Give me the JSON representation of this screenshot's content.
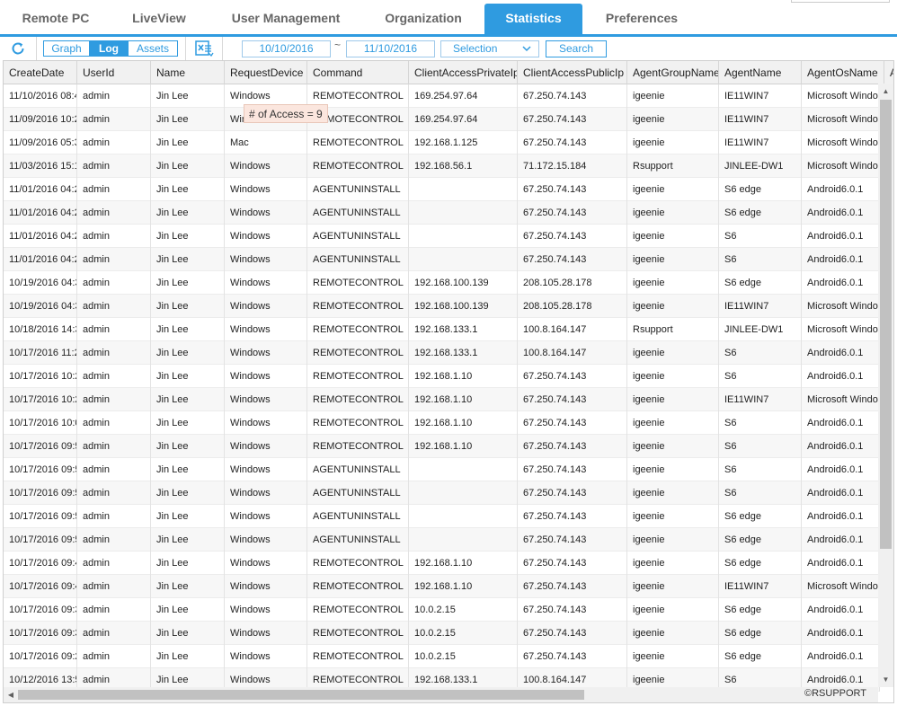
{
  "tabs": [
    {
      "label": "Remote PC",
      "active": false
    },
    {
      "label": "LiveView",
      "active": false
    },
    {
      "label": "User Management",
      "active": false
    },
    {
      "label": "Organization",
      "active": false
    },
    {
      "label": "Statistics",
      "active": true
    },
    {
      "label": "Preferences",
      "active": false
    }
  ],
  "toolbar": {
    "refresh_icon": "refresh-icon",
    "view_modes": [
      {
        "label": "Graph",
        "active": false
      },
      {
        "label": "Log",
        "active": true
      },
      {
        "label": "Assets",
        "active": false
      }
    ],
    "export_icon": "excel-export-icon",
    "date_from": "10/10/2016",
    "date_sep": "~",
    "date_to": "11/10/2016",
    "selection_label": "Selection",
    "search_label": "Search"
  },
  "tooltip": "# of Access = 9",
  "table": {
    "columns": [
      "CreateDate",
      "UserId",
      "Name",
      "RequestDevice",
      "Command",
      "ClientAccessPrivateIp",
      "ClientAccessPublicIp",
      "AgentGroupName",
      "AgentName",
      "AgentOsName",
      "A"
    ],
    "rows": [
      [
        "11/10/2016 08:4",
        "admin",
        "Jin Lee",
        "Windows",
        "REMOTECONTROL",
        "169.254.97.64",
        "67.250.74.143",
        "igeenie",
        "IE11WIN7",
        "Microsoft Window"
      ],
      [
        "11/09/2016 10:2",
        "admin",
        "Jin Lee",
        "Wir",
        "REMOTECONTROL",
        "169.254.97.64",
        "67.250.74.143",
        "igeenie",
        "IE11WIN7",
        "Microsoft Window"
      ],
      [
        "11/09/2016 05:3",
        "admin",
        "Jin Lee",
        "Mac",
        "REMOTECONTROL",
        "192.168.1.125",
        "67.250.74.143",
        "igeenie",
        "IE11WIN7",
        "Microsoft Window"
      ],
      [
        "11/03/2016 15:1",
        "admin",
        "Jin Lee",
        "Windows",
        "REMOTECONTROL",
        "192.168.56.1",
        "71.172.15.184",
        "Rsupport",
        "JINLEE-DW1",
        "Microsoft Window"
      ],
      [
        "11/01/2016 04:2",
        "admin",
        "Jin Lee",
        "Windows",
        "AGENTUNINSTALL",
        "",
        "67.250.74.143",
        "igeenie",
        "S6 edge",
        "Android6.0.1"
      ],
      [
        "11/01/2016 04:2",
        "admin",
        "Jin Lee",
        "Windows",
        "AGENTUNINSTALL",
        "",
        "67.250.74.143",
        "igeenie",
        "S6 edge",
        "Android6.0.1"
      ],
      [
        "11/01/2016 04:2",
        "admin",
        "Jin Lee",
        "Windows",
        "AGENTUNINSTALL",
        "",
        "67.250.74.143",
        "igeenie",
        "S6",
        "Android6.0.1"
      ],
      [
        "11/01/2016 04:2",
        "admin",
        "Jin Lee",
        "Windows",
        "AGENTUNINSTALL",
        "",
        "67.250.74.143",
        "igeenie",
        "S6",
        "Android6.0.1"
      ],
      [
        "10/19/2016 04:3",
        "admin",
        "Jin Lee",
        "Windows",
        "REMOTECONTROL",
        "192.168.100.139",
        "208.105.28.178",
        "igeenie",
        "S6 edge",
        "Android6.0.1"
      ],
      [
        "10/19/2016 04:3",
        "admin",
        "Jin Lee",
        "Windows",
        "REMOTECONTROL",
        "192.168.100.139",
        "208.105.28.178",
        "igeenie",
        "IE11WIN7",
        "Microsoft Window"
      ],
      [
        "10/18/2016 14:3",
        "admin",
        "Jin Lee",
        "Windows",
        "REMOTECONTROL",
        "192.168.133.1",
        "100.8.164.147",
        "Rsupport",
        "JINLEE-DW1",
        "Microsoft Window"
      ],
      [
        "10/17/2016 11:2",
        "admin",
        "Jin Lee",
        "Windows",
        "REMOTECONTROL",
        "192.168.133.1",
        "100.8.164.147",
        "igeenie",
        "S6",
        "Android6.0.1"
      ],
      [
        "10/17/2016 10:2",
        "admin",
        "Jin Lee",
        "Windows",
        "REMOTECONTROL",
        "192.168.1.10",
        "67.250.74.143",
        "igeenie",
        "S6",
        "Android6.0.1"
      ],
      [
        "10/17/2016 10:2",
        "admin",
        "Jin Lee",
        "Windows",
        "REMOTECONTROL",
        "192.168.1.10",
        "67.250.74.143",
        "igeenie",
        "IE11WIN7",
        "Microsoft Window"
      ],
      [
        "10/17/2016 10:0",
        "admin",
        "Jin Lee",
        "Windows",
        "REMOTECONTROL",
        "192.168.1.10",
        "67.250.74.143",
        "igeenie",
        "S6",
        "Android6.0.1"
      ],
      [
        "10/17/2016 09:5",
        "admin",
        "Jin Lee",
        "Windows",
        "REMOTECONTROL",
        "192.168.1.10",
        "67.250.74.143",
        "igeenie",
        "S6",
        "Android6.0.1"
      ],
      [
        "10/17/2016 09:5",
        "admin",
        "Jin Lee",
        "Windows",
        "AGENTUNINSTALL",
        "",
        "67.250.74.143",
        "igeenie",
        "S6",
        "Android6.0.1"
      ],
      [
        "10/17/2016 09:5",
        "admin",
        "Jin Lee",
        "Windows",
        "AGENTUNINSTALL",
        "",
        "67.250.74.143",
        "igeenie",
        "S6",
        "Android6.0.1"
      ],
      [
        "10/17/2016 09:5",
        "admin",
        "Jin Lee",
        "Windows",
        "AGENTUNINSTALL",
        "",
        "67.250.74.143",
        "igeenie",
        "S6 edge",
        "Android6.0.1"
      ],
      [
        "10/17/2016 09:5",
        "admin",
        "Jin Lee",
        "Windows",
        "AGENTUNINSTALL",
        "",
        "67.250.74.143",
        "igeenie",
        "S6 edge",
        "Android6.0.1"
      ],
      [
        "10/17/2016 09:4",
        "admin",
        "Jin Lee",
        "Windows",
        "REMOTECONTROL",
        "192.168.1.10",
        "67.250.74.143",
        "igeenie",
        "S6 edge",
        "Android6.0.1"
      ],
      [
        "10/17/2016 09:4",
        "admin",
        "Jin Lee",
        "Windows",
        "REMOTECONTROL",
        "192.168.1.10",
        "67.250.74.143",
        "igeenie",
        "IE11WIN7",
        "Microsoft Window"
      ],
      [
        "10/17/2016 09:3",
        "admin",
        "Jin Lee",
        "Windows",
        "REMOTECONTROL",
        "10.0.2.15",
        "67.250.74.143",
        "igeenie",
        "S6 edge",
        "Android6.0.1"
      ],
      [
        "10/17/2016 09:3",
        "admin",
        "Jin Lee",
        "Windows",
        "REMOTECONTROL",
        "10.0.2.15",
        "67.250.74.143",
        "igeenie",
        "S6 edge",
        "Android6.0.1"
      ],
      [
        "10/17/2016 09:2",
        "admin",
        "Jin Lee",
        "Windows",
        "REMOTECONTROL",
        "10.0.2.15",
        "67.250.74.143",
        "igeenie",
        "S6 edge",
        "Android6.0.1"
      ],
      [
        "10/12/2016 13:5",
        "admin",
        "Jin Lee",
        "Windows",
        "REMOTECONTROL",
        "192.168.133.1",
        "100.8.164.147",
        "igeenie",
        "S6",
        "Android6.0.1"
      ]
    ]
  },
  "footer": {
    "copyright": "©RSUPPORT"
  },
  "colors": {
    "accent": "#2f9be0",
    "tooltip_bg": "#fbe6de",
    "header_bg": "#f1f1f1"
  }
}
